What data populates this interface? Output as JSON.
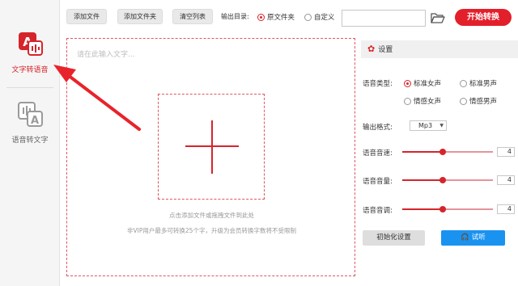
{
  "sidebar": {
    "items": [
      {
        "label": "文字转语音",
        "icon": "text-to-speech-icon",
        "active": true
      },
      {
        "label": "语音转文字",
        "icon": "speech-to-text-icon",
        "active": false
      }
    ]
  },
  "toolbar": {
    "add_file": "添加文件",
    "add_folder": "添加文件夹",
    "clear_list": "清空列表",
    "output_label": "输出目录:",
    "output_options": [
      {
        "label": "原文件夹",
        "selected": true
      },
      {
        "label": "自定义",
        "selected": false
      }
    ],
    "path_value": "",
    "folder_icon": "folder-icon",
    "start_button": "开始转换"
  },
  "editor": {
    "placeholder": "请在此输入文字...",
    "hint_upload": "点击添加文件或拖拽文件到此处",
    "hint_limit": "非VIP用户最多可转换25个字，升级为会员转换字数将不受限制"
  },
  "settings": {
    "title": "设置",
    "voice_type_label": "语音类型:",
    "voice_options": [
      {
        "label": "标准女声",
        "selected": true
      },
      {
        "label": "标准男声",
        "selected": false
      },
      {
        "label": "情感女声",
        "selected": false
      },
      {
        "label": "情感男声",
        "selected": false
      }
    ],
    "format_label": "输出格式:",
    "format_value": "Mp3",
    "speed_label": "语音音速:",
    "speed_value": "4",
    "volume_label": "语音音量:",
    "volume_value": "4",
    "pitch_label": "语音音调:",
    "pitch_value": "4",
    "slider_level": 0.45,
    "reset_button": "初始化设置",
    "listen_button": "试听"
  },
  "colors": {
    "accent": "#e31f2b",
    "listen_blue": "#1a93f0"
  }
}
